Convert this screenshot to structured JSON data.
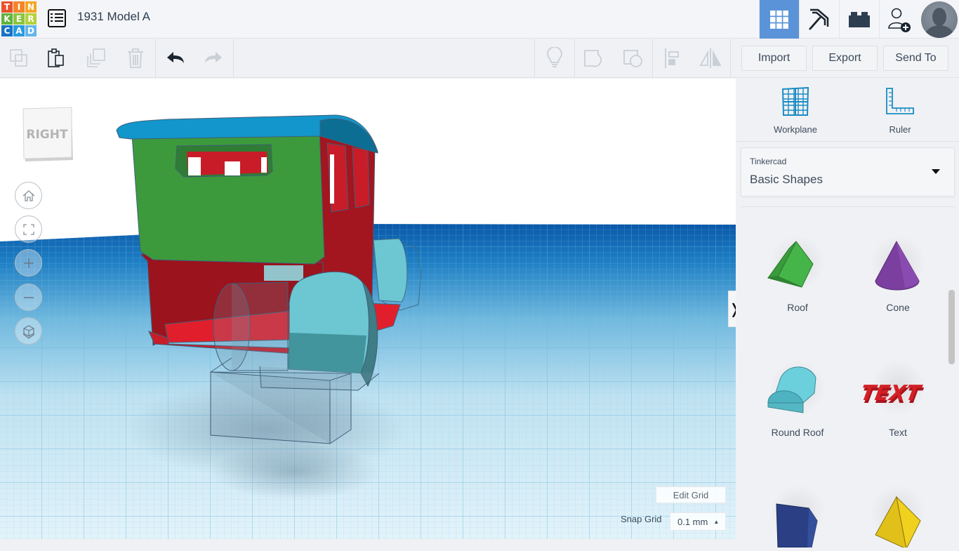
{
  "app": {
    "logo_letters": [
      "T",
      "I",
      "N",
      "K",
      "E",
      "R",
      "C",
      "A",
      "D"
    ],
    "logo_colors": [
      "#e8532c",
      "#f58529",
      "#f5a623",
      "#61b33b",
      "#8cc43f",
      "#b4d23a",
      "#1774c6",
      "#2a9ae1",
      "#64b5ea"
    ],
    "design_title": "1931 Model A"
  },
  "header": {
    "buttons": [
      {
        "name": "3d-design-view",
        "icon": "grid-icon",
        "active": true
      },
      {
        "name": "codeblocks-view",
        "icon": "pickaxe-icon",
        "active": false
      },
      {
        "name": "bricks-view",
        "icon": "lego-brick-icon",
        "active": false
      },
      {
        "name": "invite-people",
        "icon": "add-user-icon",
        "active": false
      }
    ],
    "accent_color": "#5b93d9"
  },
  "toolbar": {
    "copy_label": "Copy",
    "paste_label": "Paste",
    "duplicate_label": "Duplicate",
    "delete_label": "Delete",
    "undo_label": "Undo",
    "redo_label": "Redo",
    "notes_label": "Notes",
    "group_label": "Group",
    "ungroup_label": "Ungroup",
    "align_label": "Align",
    "mirror_label": "Mirror",
    "import_label": "Import",
    "export_label": "Export",
    "send_to_label": "Send To"
  },
  "viewport": {
    "view_cube_face": "RIGHT",
    "nav": [
      "Home view",
      "Fit all",
      "Zoom in",
      "Zoom out",
      "Orthographic / perspective"
    ],
    "edit_grid_label": "Edit Grid",
    "snap_grid_label": "Snap Grid",
    "snap_grid_value": "0.1 mm",
    "collapse_glyph": "❭"
  },
  "panel": {
    "workplane_label": "Workplane",
    "ruler_label": "Ruler",
    "library_provider": "Tinkercad",
    "library_name": "Basic Shapes",
    "shapes": [
      {
        "label": "Roof",
        "color": "#3fa83a"
      },
      {
        "label": "Cone",
        "color": "#7b3fa0"
      },
      {
        "label": "Round Roof",
        "color": "#5ec5d3"
      },
      {
        "label": "Text",
        "color": "#d41f26"
      },
      {
        "label": "",
        "color": "#2a3f84"
      },
      {
        "label": "",
        "color": "#e9c71c"
      }
    ]
  }
}
